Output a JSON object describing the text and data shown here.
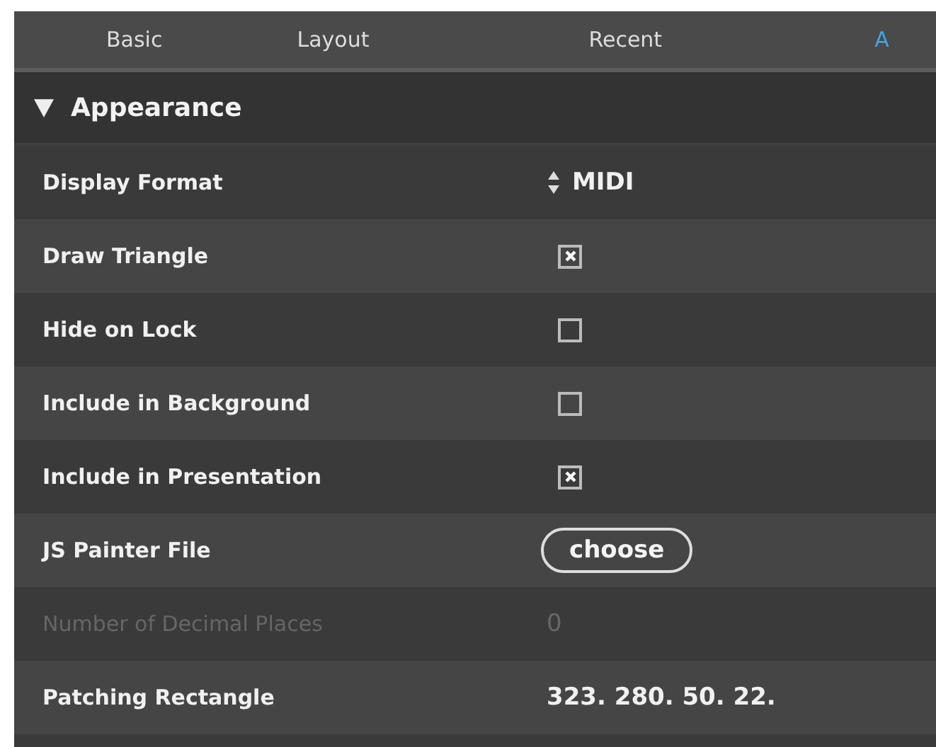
{
  "tabs": [
    {
      "label": "Basic",
      "selected": false
    },
    {
      "label": "Layout",
      "selected": false
    },
    {
      "label": "Recent",
      "selected": false
    },
    {
      "label": "A",
      "selected": true
    }
  ],
  "section": {
    "title": "Appearance",
    "expanded": true
  },
  "rows": [
    {
      "kind": "enum",
      "label": "Display Format",
      "value": "MIDI",
      "disabled": false
    },
    {
      "kind": "checkbox",
      "label": "Draw Triangle",
      "checked": true,
      "disabled": false
    },
    {
      "kind": "checkbox",
      "label": "Hide on Lock",
      "checked": false,
      "disabled": false
    },
    {
      "kind": "checkbox",
      "label": "Include in Background",
      "checked": false,
      "disabled": false
    },
    {
      "kind": "checkbox",
      "label": "Include in Presentation",
      "checked": true,
      "disabled": false
    },
    {
      "kind": "button",
      "label": "JS Painter File",
      "value": "choose",
      "disabled": false
    },
    {
      "kind": "text",
      "label": "Number of Decimal Places",
      "value": "0",
      "disabled": true
    },
    {
      "kind": "text",
      "label": "Patching Rectangle",
      "value": "323. 280. 50. 22.",
      "disabled": false
    }
  ]
}
